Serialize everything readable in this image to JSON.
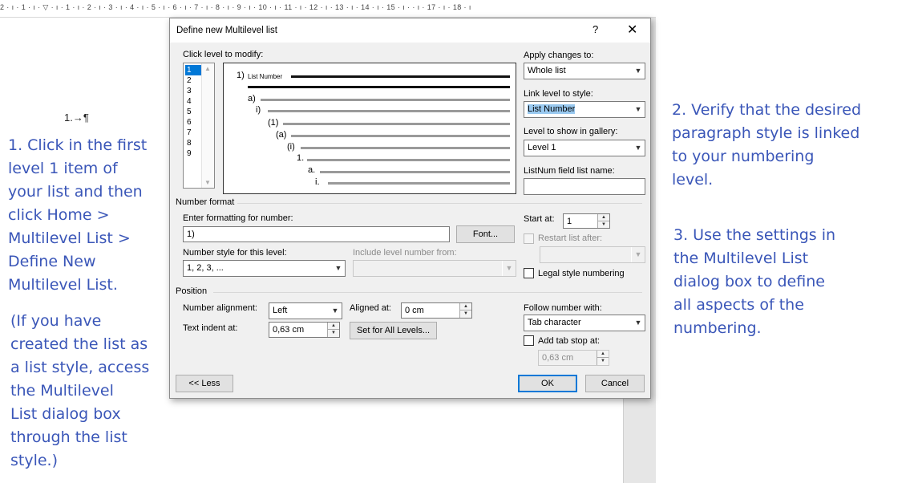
{
  "ruler": {
    "text": "2 · ı · 1 · ı · ▽ · ı ·  1 · ı · 2 · ı · 3 · ı · 4 · ı · 5 · ı · 6 · ı · 7 · ı · 8 · ı · 9 · ı · 10 · ı · 11 · ı · 12 · ı · 13 · ı · 14 · ı · 15 · ı ·   · ı · 17 · ı · 18 · ı"
  },
  "document": {
    "list_number": "1.→¶"
  },
  "notes": {
    "left_1": "1. Click in the first\nlevel 1 item of\nyour list and then\nclick Home >\nMultilevel List >\nDefine New\nMultilevel List.",
    "left_2": "(If you have\ncreated the list as\na list style, access\nthe Multilevel\nList dialog box\nthrough the list\nstyle.)",
    "right_1": "2. Verify that the desired\nparagraph style is linked\nto your numbering\nlevel.",
    "right_2": "3. Use the settings in\nthe Multilevel List\ndialog box to define\nall aspects of the\nnumbering."
  },
  "dialog": {
    "title": "Define new Multilevel list",
    "help": "?",
    "close": "✕",
    "click_level_label": "Click level to modify:",
    "levels": [
      "1",
      "2",
      "3",
      "4",
      "5",
      "6",
      "7",
      "8",
      "9"
    ],
    "selected_level": "1",
    "preview": {
      "numbers": [
        "1)",
        "a)",
        "i)",
        "(1)",
        "(a)",
        "(i)",
        "1.",
        "a.",
        "i."
      ],
      "list_number_label": "List Number"
    },
    "apply_changes_label": "Apply changes to:",
    "apply_changes_value": "Whole list",
    "link_level_label": "Link level to style:",
    "link_level_value": "List Number",
    "show_gallery_label": "Level to show in gallery:",
    "show_gallery_value": "Level 1",
    "listnum_label": "ListNum field list name:",
    "listnum_value": "",
    "number_format_group": "Number format",
    "enter_formatting_label": "Enter formatting for number:",
    "enter_formatting_value": "1)",
    "font_button": "Font...",
    "number_style_label": "Number style for this level:",
    "number_style_value": "1, 2, 3, ...",
    "include_level_label": "Include level number from:",
    "include_level_value": "",
    "start_at_label": "Start at:",
    "start_at_value": "1",
    "restart_label": "Restart list after:",
    "restart_value": "",
    "legal_label": "Legal style numbering",
    "position_group": "Position",
    "number_alignment_label": "Number alignment:",
    "number_alignment_value": "Left",
    "aligned_at_label": "Aligned at:",
    "aligned_at_value": "0 cm",
    "text_indent_label": "Text indent at:",
    "text_indent_value": "0,63 cm",
    "set_all_levels_button": "Set for All Levels...",
    "follow_number_label": "Follow number with:",
    "follow_number_value": "Tab character",
    "add_tab_label": "Add tab stop at:",
    "add_tab_value": "0,63 cm",
    "less_button": "<< Less",
    "ok_button": "OK",
    "cancel_button": "Cancel"
  }
}
